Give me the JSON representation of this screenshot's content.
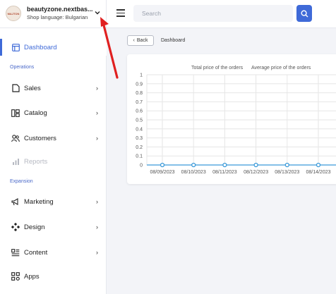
{
  "store": {
    "logo_text": "MAJTON",
    "name": "beautyzone.nextbas...",
    "language": "Shop language: Bulgarian"
  },
  "sidebar": {
    "active": {
      "label": "Dashboard",
      "icon": "dashboard-icon"
    },
    "sections": [
      {
        "title": "Operations",
        "items": [
          {
            "label": "Sales",
            "icon": "sales-icon",
            "has_children": true
          },
          {
            "label": "Catalog",
            "icon": "catalog-icon",
            "has_children": true
          },
          {
            "label": "Customers",
            "icon": "customers-icon",
            "has_children": true
          },
          {
            "label": "Reports",
            "icon": "reports-icon",
            "disabled": true
          }
        ]
      },
      {
        "title": "Expansion",
        "items": [
          {
            "label": "Marketing",
            "icon": "marketing-icon",
            "has_children": true
          },
          {
            "label": "Design",
            "icon": "design-icon",
            "has_children": true
          },
          {
            "label": "Content",
            "icon": "content-icon",
            "has_children": true
          },
          {
            "label": "Apps",
            "icon": "apps-icon"
          }
        ]
      }
    ]
  },
  "topbar": {
    "search_placeholder": "Search"
  },
  "page": {
    "back_label": "Back",
    "breadcrumb": "Dashboard"
  },
  "colors": {
    "accent": "#3f6ad8",
    "line": "#3b9ad9",
    "annotation_arrow": "#e02020"
  },
  "chart_data": {
    "type": "line",
    "legend": [
      "Total price of the orders",
      "Average price of the orders"
    ],
    "x": [
      "08/09/2023",
      "08/10/2023",
      "08/11/2023",
      "08/12/2023",
      "08/13/2023",
      "08/14/2023"
    ],
    "series": [
      {
        "name": "Total price of the orders",
        "values": [
          0,
          0,
          0,
          0,
          0,
          0,
          0
        ]
      }
    ],
    "yticks": [
      0,
      0.1,
      0.2,
      0.3,
      0.4,
      0.5,
      0.6,
      0.7,
      0.8,
      0.9,
      1.0
    ],
    "ylim": [
      0,
      1.0
    ],
    "grid": true
  }
}
